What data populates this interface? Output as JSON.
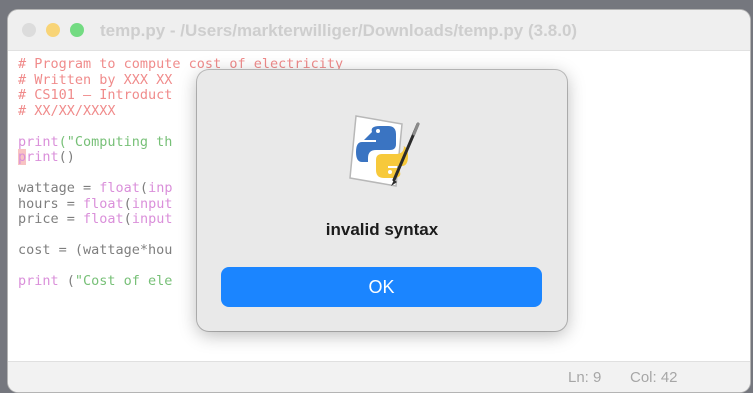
{
  "window": {
    "title": "temp.py - /Users/markterwilliger/Downloads/temp.py (3.8.0)"
  },
  "editor": {
    "lines": [
      [
        {
          "t": "# Program to compute cost of electricity",
          "c": "comment"
        }
      ],
      [
        {
          "t": "# Written by XXX XX",
          "c": "comment"
        }
      ],
      [
        {
          "t": "# CS101 — Introduct",
          "c": "comment"
        }
      ],
      [
        {
          "t": "# XX/XX/XXXX",
          "c": "comment"
        }
      ],
      [],
      [
        {
          "t": "print",
          "c": "builtin"
        },
        {
          "t": "(\"Computing th",
          "c": "string"
        }
      ],
      [
        {
          "t": "p",
          "c": "builtin cursor"
        },
        {
          "t": "rint",
          "c": "builtin"
        },
        {
          "t": "()",
          "c": "default"
        }
      ],
      [],
      [
        {
          "t": "wattage = ",
          "c": "default"
        },
        {
          "t": "float",
          "c": "builtin"
        },
        {
          "t": "(",
          "c": "default"
        },
        {
          "t": "inp",
          "c": "builtin"
        }
      ],
      [
        {
          "t": "hours = ",
          "c": "default"
        },
        {
          "t": "float",
          "c": "builtin"
        },
        {
          "t": "(",
          "c": "default"
        },
        {
          "t": "input",
          "c": "builtin"
        }
      ],
      [
        {
          "t": "price = ",
          "c": "default"
        },
        {
          "t": "float",
          "c": "builtin"
        },
        {
          "t": "(",
          "c": "default"
        },
        {
          "t": "input",
          "c": "builtin"
        }
      ],
      [],
      [
        {
          "t": "cost = (wattage*hou",
          "c": "default"
        }
      ],
      [],
      [
        {
          "t": "print",
          "c": "builtin"
        },
        {
          "t": " (",
          "c": "default"
        },
        {
          "t": "\"Cost of ele",
          "c": "string"
        }
      ]
    ]
  },
  "statusbar": {
    "ln": "Ln: 9",
    "col": "Col: 42"
  },
  "dialog": {
    "icon": "python-idle-icon",
    "message": "invalid syntax",
    "ok_label": "OK"
  },
  "colors": {
    "comment": "#e84e4e",
    "builtin": "#c653c6",
    "string": "#2e9e2e",
    "ok_button": "#1b85ff",
    "traffic_min": "#f5bd2f",
    "traffic_max": "#28c840"
  }
}
